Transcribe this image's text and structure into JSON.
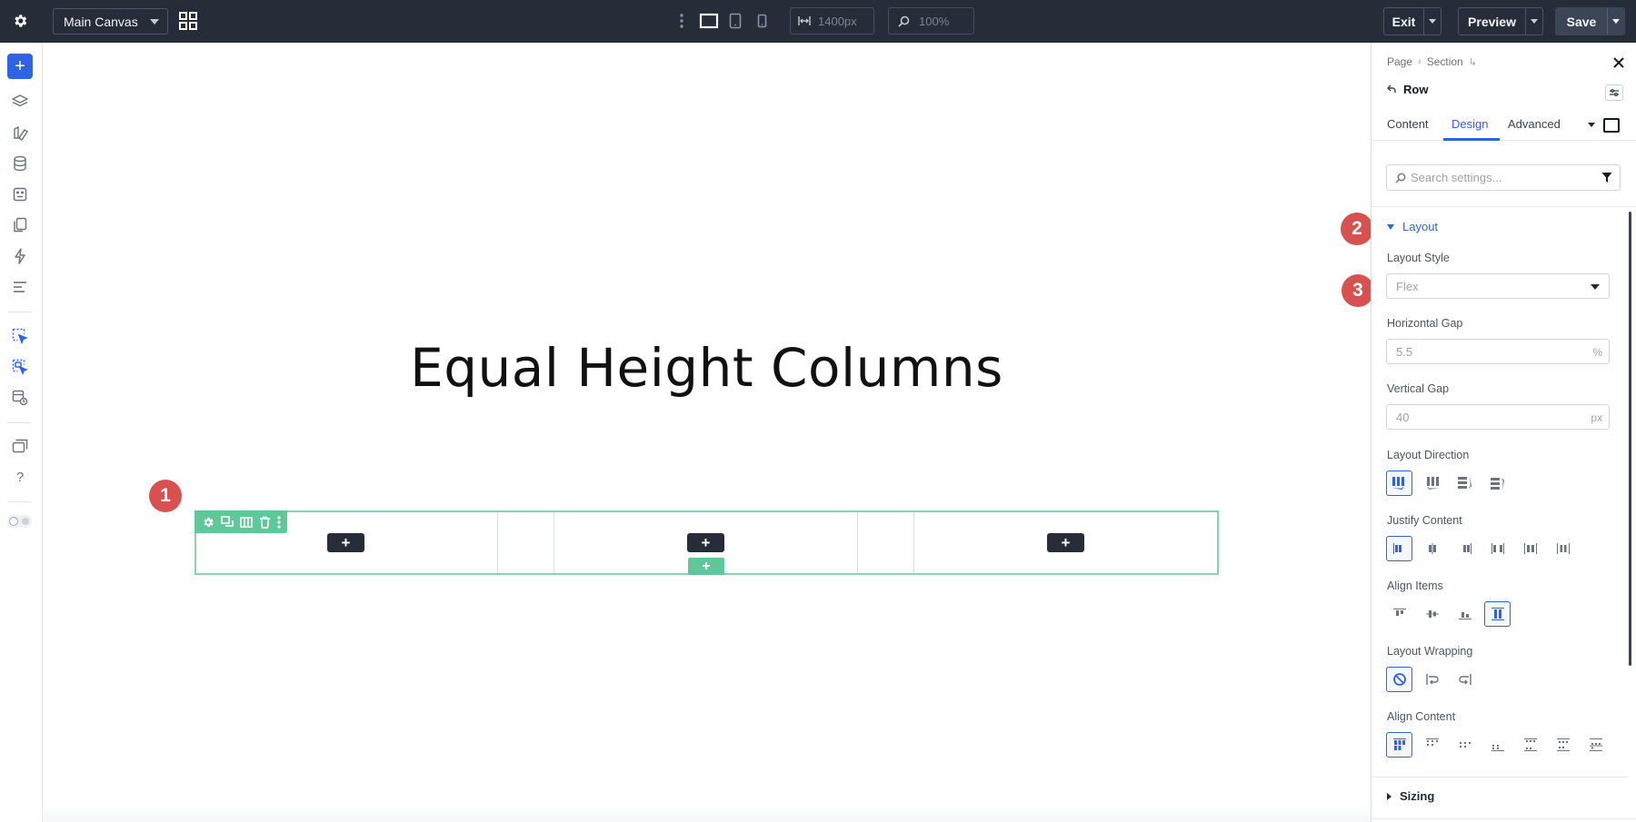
{
  "topbar": {
    "canvas_select": "Main Canvas",
    "width_value": "1400px",
    "zoom_value": "100%",
    "exit_label": "Exit",
    "preview_label": "Preview",
    "save_label": "Save"
  },
  "leftbar": {
    "add_label": "+",
    "help_label": "?"
  },
  "canvas": {
    "heading": "Equal Height Columns",
    "add_module_label": "+",
    "add_row_label": "+",
    "markers": [
      "1",
      "2",
      "3"
    ]
  },
  "panel": {
    "breadcrumb": [
      "Page",
      "Section"
    ],
    "element_title": "Row",
    "tabs": [
      "Content",
      "Design",
      "Advanced"
    ],
    "active_tab": "Design",
    "search_placeholder": "Search settings...",
    "layout_section": "Layout",
    "layout_style_label": "Layout Style",
    "layout_style_value": "Flex",
    "horizontal_gap_label": "Horizontal Gap",
    "horizontal_gap_value": "5.5",
    "horizontal_gap_unit": "%",
    "vertical_gap_label": "Vertical Gap",
    "vertical_gap_value": "40",
    "vertical_gap_unit": "px",
    "layout_direction_label": "Layout Direction",
    "justify_content_label": "Justify Content",
    "align_items_label": "Align Items",
    "layout_wrapping_label": "Layout Wrapping",
    "align_content_label": "Align Content",
    "sizing_section": "Sizing"
  },
  "colors": {
    "topbar_bg": "#262d39",
    "accent_blue": "#2f63e6",
    "row_green": "#5fc79a",
    "marker_red": "#d85151"
  }
}
